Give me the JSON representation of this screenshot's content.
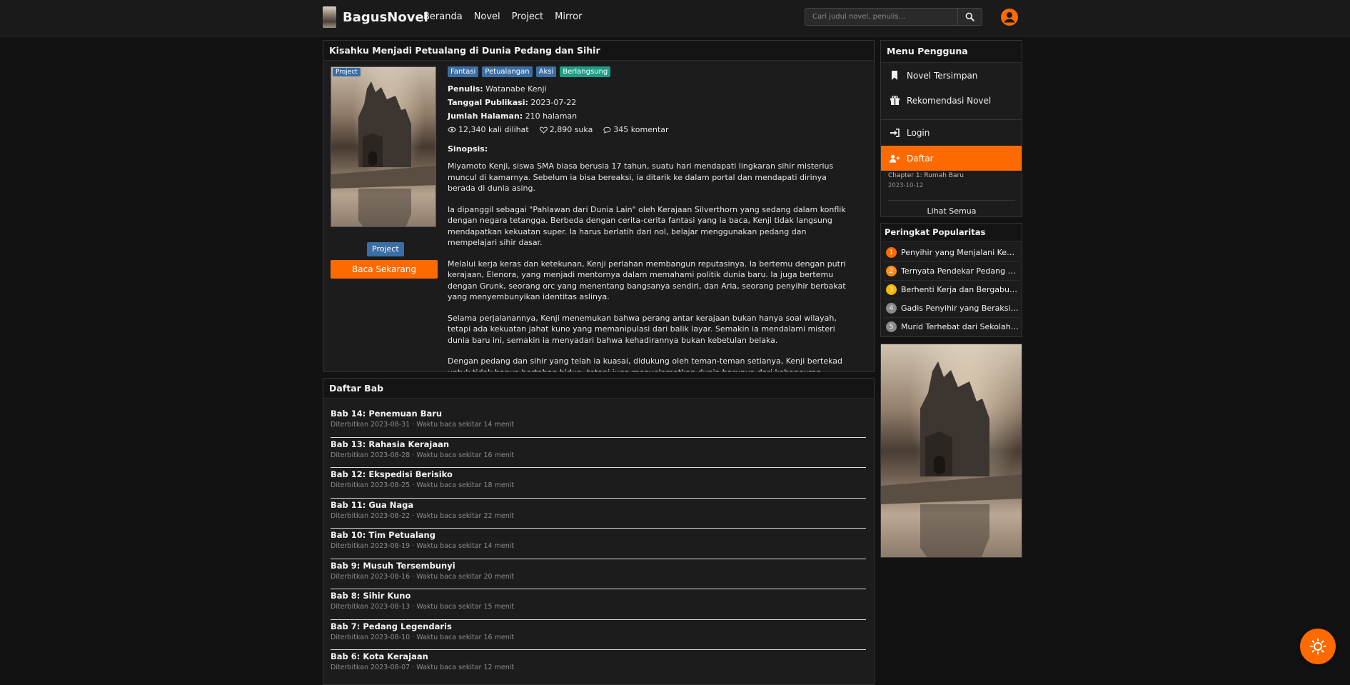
{
  "nav": {
    "brand": "BagusNovel",
    "links": [
      "Beranda",
      "Novel",
      "Project",
      "Mirror"
    ],
    "search_placeholder": "Cari judul novel, penulis..."
  },
  "novel": {
    "title": "Kisahku Menjadi Petualang di Dunia Pedang dan Sihir",
    "cover_badge": "Project",
    "tags": [
      "Fantasi",
      "Petualangan",
      "Aksi",
      "Berlangsung"
    ],
    "author_label": "Penulis:",
    "author": "Watanabe Kenji",
    "published_label": "Tanggal Publikasi:",
    "published": "2023-07-22",
    "pages_label": "Jumlah Halaman:",
    "pages": "210 halaman",
    "views": "12,340 kali dilihat",
    "likes": "2,890 suka",
    "comments": "345 komentar",
    "synopsis_label": "Sinopsis:",
    "synopsis": [
      "Miyamoto Kenji, siswa SMA biasa berusia 17 tahun, suatu hari mendapati lingkaran sihir misterius muncul di kamarnya. Sebelum ia bisa bereaksi, ia ditarik ke dalam portal dan mendapati dirinya berada di dunia asing.",
      "Ia dipanggil sebagai \"Pahlawan dari Dunia Lain\" oleh Kerajaan Silverthorn yang sedang dalam konflik dengan negara tetangga. Berbeda dengan cerita-cerita fantasi yang ia baca, Kenji tidak langsung mendapatkan kekuatan super. Ia harus berlatih dari nol, belajar menggunakan pedang dan mempelajari sihir dasar.",
      "Melalui kerja keras dan ketekunan, Kenji perlahan membangun reputasinya. Ia bertemu dengan putri kerajaan, Elenora, yang menjadi mentornya dalam memahami politik dunia baru. Ia juga bertemu dengan Grunk, seorang orc yang menentang bangsanya sendiri, dan Aria, seorang penyihir berbakat yang menyembunyikan identitas aslinya.",
      "Selama perjalanannya, Kenji menemukan bahwa perang antar kerajaan bukan hanya soal wilayah, tetapi ada kekuatan jahat kuno yang memanipulasi dari balik layar. Semakin ia mendalami misteri dunia baru ini, semakin ia menyadari bahwa kehadirannya bukan kebetulan belaka.",
      "Dengan pedang dan sihir yang telah ia kuasai, didukung oleh teman-teman setianya, Kenji bertekad untuk tidak hanya bertahan hidup, tetapi juga menyelamatkan dunia barunya dari kehancuran."
    ],
    "project_button": "Project",
    "read_button": "Baca Sekarang"
  },
  "chapters": {
    "title": "Daftar Bab",
    "items": [
      {
        "title": "Bab 14: Penemuan Baru",
        "meta": "Diterbitkan 2023-08-31 · Waktu baca sekitar 14 menit"
      },
      {
        "title": "Bab 13: Rahasia Kerajaan",
        "meta": "Diterbitkan 2023-08-28 · Waktu baca sekitar 16 menit"
      },
      {
        "title": "Bab 12: Ekspedisi Berisiko",
        "meta": "Diterbitkan 2023-08-25 · Waktu baca sekitar 18 menit"
      },
      {
        "title": "Bab 11: Gua Naga",
        "meta": "Diterbitkan 2023-08-22 · Waktu baca sekitar 22 menit"
      },
      {
        "title": "Bab 10: Tim Petualang",
        "meta": "Diterbitkan 2023-08-19 · Waktu baca sekitar 14 menit"
      },
      {
        "title": "Bab 9: Musuh Tersembunyi",
        "meta": "Diterbitkan 2023-08-16 · Waktu baca sekitar 20 menit"
      },
      {
        "title": "Bab 8: Sihir Kuno",
        "meta": "Diterbitkan 2023-08-13 · Waktu baca sekitar 15 menit"
      },
      {
        "title": "Bab 7: Pedang Legendaris",
        "meta": "Diterbitkan 2023-08-10 · Waktu baca sekitar 16 menit"
      },
      {
        "title": "Bab 6: Kota Kerajaan",
        "meta": "Diterbitkan 2023-08-07 · Waktu baca sekitar 12 menit"
      }
    ]
  },
  "user_menu": {
    "title": "Menu Pengguna",
    "saved": "Novel Tersimpan",
    "recommend": "Rekomendasi Novel",
    "login": "Login",
    "register": "Daftar",
    "behind_chapter": "Chapter 1: Rumah Baru",
    "behind_date": "2023-10-12",
    "see_all": "Lihat Semua"
  },
  "popularity": {
    "title": "Peringkat Popularitas",
    "items": [
      {
        "rank": "1",
        "title": "Penyihir yang Menjalani Kehidupan Baru",
        "color": "#ff6a00"
      },
      {
        "rank": "2",
        "title": "Ternyata Pendekar Pedang Terkuat",
        "color": "#ff8c1a"
      },
      {
        "rank": "3",
        "title": "Berhenti Kerja dan Bergabung dengan Guild",
        "color": "#f5b700"
      },
      {
        "rank": "4",
        "title": "Gadis Penyihir yang Beraksi di Kota",
        "color": "#8a8a8a"
      },
      {
        "rank": "5",
        "title": "Murid Terhebat dari Sekolah Sihir",
        "color": "#8a8a8a"
      }
    ]
  },
  "colors": {
    "accent": "#ff6a00",
    "tag_blue": "#3a6ea5",
    "tag_green": "#1f9e85"
  },
  "icons": {
    "search": "search-icon",
    "user": "user-circle-icon",
    "theme": "sun-icon"
  }
}
